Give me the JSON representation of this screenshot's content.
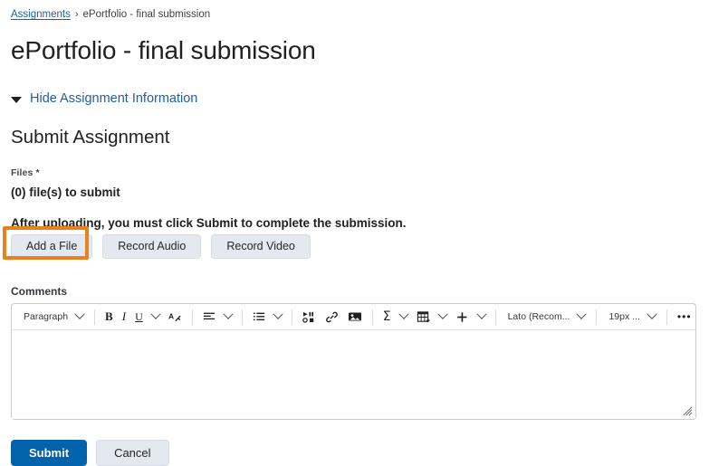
{
  "breadcrumb": {
    "link_label": "Assignments",
    "separator": "›",
    "current_label": "ePortfolio - final submission"
  },
  "page_title": "ePortfolio - final submission",
  "assignment_info_toggle": {
    "label": "Hide Assignment Information",
    "icon": "triangle-down-icon"
  },
  "submit_section": {
    "heading": "Submit Assignment",
    "files_label": "Files *",
    "files_count_text": "(0) file(s) to submit",
    "upload_note": "After uploading, you must click Submit to complete the submission.",
    "buttons": [
      {
        "label": "Add a File",
        "highlighted": true
      },
      {
        "label": "Record Audio",
        "highlighted": false
      },
      {
        "label": "Record Video",
        "highlighted": false
      }
    ]
  },
  "comments": {
    "label": "Comments",
    "value": "",
    "placeholder": ""
  },
  "editor_toolbar": {
    "format_select": {
      "value": "Paragraph",
      "icon": "chevron-down-icon"
    },
    "bold": {
      "label": "B",
      "icon": "bold-icon"
    },
    "italic": {
      "label": "I",
      "icon": "italic-icon"
    },
    "underline": {
      "label": "U",
      "icon": "underline-icon"
    },
    "text_style": {
      "icon": "text-color-icon"
    },
    "align": {
      "icon": "align-left-icon"
    },
    "list": {
      "icon": "bulleted-list-icon"
    },
    "media": {
      "icon": "insert-media-icon"
    },
    "link": {
      "icon": "link-icon"
    },
    "image": {
      "icon": "image-icon"
    },
    "equation": {
      "icon": "sigma-equation-icon"
    },
    "table": {
      "icon": "insert-table-icon"
    },
    "add": {
      "icon": "plus-icon"
    },
    "font_family_select": {
      "value": "Lato (Recom...",
      "icon": "chevron-down-icon"
    },
    "font_size_select": {
      "value": "19px ...",
      "icon": "chevron-down-icon"
    },
    "more_options": {
      "label": "•••",
      "icon": "ellipsis-icon"
    },
    "fullscreen": {
      "icon": "fullscreen-expand-icon"
    },
    "resize_handle": {
      "icon": "resize-grip-icon"
    }
  },
  "footer": {
    "submit_label": "Submit",
    "cancel_label": "Cancel"
  },
  "colors": {
    "link_blue": "#1a5faa",
    "primary_blue": "#0362ac",
    "highlight_orange": "#e8821e",
    "button_grey": "#e4e8ef"
  }
}
